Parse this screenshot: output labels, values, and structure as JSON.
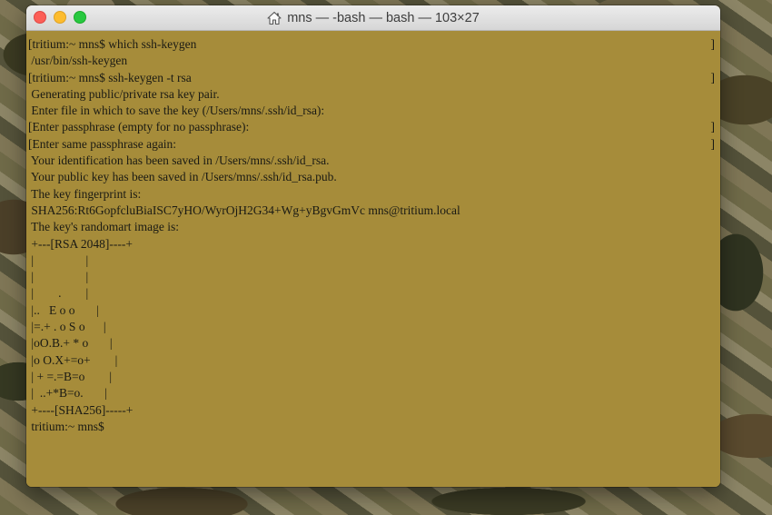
{
  "window": {
    "title": "mns — -bash — bash — 103×27",
    "title_icon": "home-icon",
    "traffic_lights": [
      "close",
      "minimize",
      "maximize"
    ]
  },
  "colors": {
    "terminal_background": "#a68c3a",
    "terminal_text": "#1a1a14",
    "close": "#fc5f57",
    "minimize": "#fdbc2e",
    "maximize": "#28c840"
  },
  "terminal": {
    "lines": [
      {
        "text": "[tritium:~ mns$ which ssh-keygen",
        "right": "]"
      },
      {
        "text": " /usr/bin/ssh-keygen",
        "right": ""
      },
      {
        "text": "[tritium:~ mns$ ssh-keygen -t rsa",
        "right": "]"
      },
      {
        "text": " Generating public/private rsa key pair.",
        "right": ""
      },
      {
        "text": " Enter file in which to save the key (/Users/mns/.ssh/id_rsa):",
        "right": ""
      },
      {
        "text": "[Enter passphrase (empty for no passphrase):",
        "right": "]"
      },
      {
        "text": "[Enter same passphrase again:",
        "right": "]"
      },
      {
        "text": " Your identification has been saved in /Users/mns/.ssh/id_rsa.",
        "right": ""
      },
      {
        "text": " Your public key has been saved in /Users/mns/.ssh/id_rsa.pub.",
        "right": ""
      },
      {
        "text": " The key fingerprint is:",
        "right": ""
      },
      {
        "text": " SHA256:Rt6GopfcluBiaISC7yHO/WyrOjH2G34+Wg+yBgvGmVc mns@tritium.local",
        "right": ""
      },
      {
        "text": " The key's randomart image is:",
        "right": ""
      },
      {
        "text": " +---[RSA 2048]----+",
        "right": ""
      },
      {
        "text": " |                 |",
        "right": ""
      },
      {
        "text": " |                 |",
        "right": ""
      },
      {
        "text": " |        .        |",
        "right": ""
      },
      {
        "text": " |..   E o o       |",
        "right": ""
      },
      {
        "text": " |=.+ . o S o      |",
        "right": ""
      },
      {
        "text": " |oO.B.+ * o       |",
        "right": ""
      },
      {
        "text": " |o O.X+=o+        |",
        "right": ""
      },
      {
        "text": " | + =.=B=o        |",
        "right": ""
      },
      {
        "text": " |  ..+*B=o.       |",
        "right": ""
      },
      {
        "text": " +----[SHA256]-----+",
        "right": ""
      },
      {
        "text": " tritium:~ mns$",
        "right": ""
      }
    ]
  }
}
